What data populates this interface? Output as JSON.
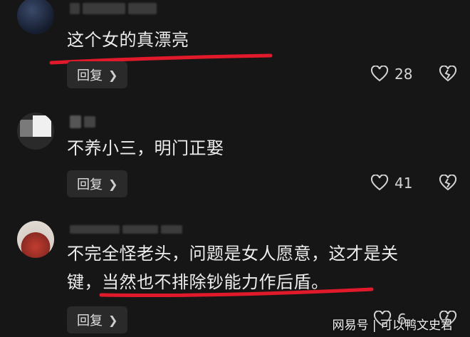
{
  "comments": [
    {
      "text": "这个女的真漂亮",
      "reply_label": "回复",
      "likes": "28",
      "avatar_color": "#1e2a44"
    },
    {
      "text": "不养小三，明门正娶",
      "reply_label": "回复",
      "likes": "41",
      "avatar_color": "#2c2c2c"
    },
    {
      "text_line1": "不完全怪老头，问题是女人愿意，这才是关",
      "text_line2": "键，当然也不排除钞能力作后盾。",
      "reply_label": "回复",
      "likes": "6",
      "avatar_color": "#a83a30"
    }
  ],
  "watermark": "网易号 | 可以鸭文史君",
  "colors": {
    "background": "#161616",
    "underline": "#e0192b",
    "button_bg": "#2a2a2a",
    "text": "#ededed"
  },
  "icons": [
    "heart-outline-icon",
    "broken-heart-icon",
    "chevron-right-icon"
  ]
}
